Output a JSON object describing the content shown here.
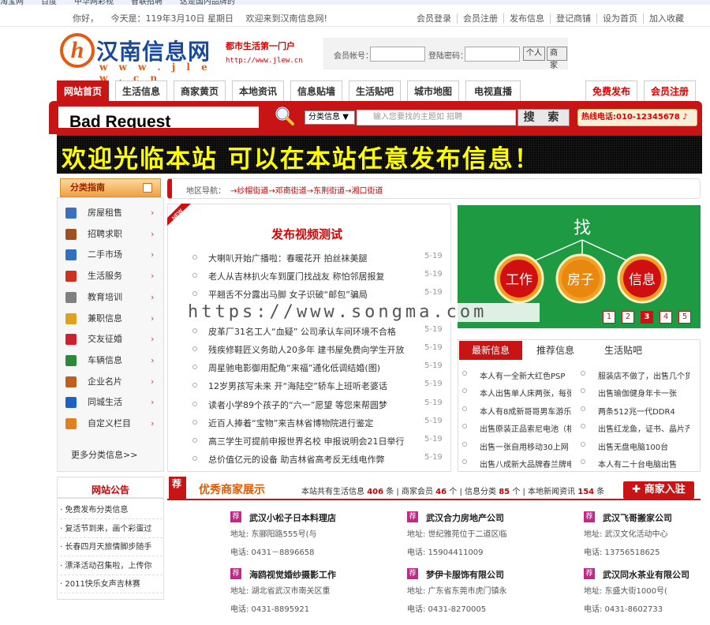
{
  "browser": {
    "bookmarks": [
      "淘宝网",
      "百度",
      "中华网彩视",
      "智联招聘",
      "这是国内品牌的"
    ]
  },
  "topbar": {
    "greeting": "你好，",
    "date": "今天是：119年3月10日 星期日",
    "welcome": "欢迎来到汉南信息网!",
    "links": [
      "会员登录",
      "会员注册",
      "发布信息",
      "登记商铺",
      "设为首页",
      "加入收藏"
    ]
  },
  "header": {
    "logo_letter": "h",
    "logo_text": "汉南信息网",
    "logo_url": "w w w . j l e w . c n",
    "slogan": "都市生活第一门户",
    "slogan_url": "http://www.jlew.cn",
    "login": {
      "account_label": "会员帐号：",
      "password_label": "登陆密码：",
      "btn_personal": "个人",
      "btn_merchant": "商家"
    }
  },
  "nav": {
    "tabs": [
      "网站首页",
      "生活信息",
      "商家黄页",
      "本地资讯",
      "信息贴墙",
      "生活贴吧",
      "城市地图",
      "电视直播"
    ],
    "right": [
      "免费发布",
      "会员注册"
    ]
  },
  "search": {
    "error_text": "Bad Request",
    "category": "分类信息",
    "placeholder": "输入您要找的主题如 招聘",
    "button": "搜 索",
    "hotline": "热线电话:010-12345678"
  },
  "banner": {
    "text": "欢迎光临本站 可以在本站任意发布信息！"
  },
  "categories": {
    "title": "分类指南",
    "items": [
      "房屋租售",
      "招聘求职",
      "二手市场",
      "生活服务",
      "教育培训",
      "兼职信息",
      "交友征婚",
      "车辆信息",
      "企业名片",
      "同城生活",
      "自定义栏目"
    ],
    "icon_colors": [
      "#3a70c0",
      "#a05020",
      "#3070c0",
      "#d03020",
      "#808080",
      "#e0a020",
      "#d02030",
      "#2a8a3a",
      "#c06020",
      "#2060c0",
      "#e08020"
    ],
    "icon_names": [
      "house-icon",
      "person-icon",
      "monitor-icon",
      "lifebuoy-icon",
      "board-icon",
      "folder-icon",
      "heart-icon",
      "car-icon",
      "card-icon",
      "chart-icon",
      "gear-icon"
    ],
    "more": "更多分类信息>>"
  },
  "area": {
    "label": "地区导航：",
    "value": "→纱帽街道→邓南街道→东荆街道→湘口街道"
  },
  "video": {
    "badge": "NEW",
    "title": "发布视频测试",
    "items": [
      {
        "text": "大喇叭开始广播啦：春暖花开 拍丝袜美腿",
        "date": "5-19"
      },
      {
        "text": "老人从吉林扒火车到厦门找战友 称怕邻居报复",
        "date": "5-19"
      },
      {
        "text": "平翘舌不分露出马脚 女子识破“邮包”骗局",
        "date": "5-19"
      },
      {
        "text": "",
        "date": ""
      },
      {
        "text": "皮革厂31名工人“血疑” 公司承认车间环境不合格",
        "date": "5-19"
      },
      {
        "text": "残疾修鞋匠义务助人20多年 建书屋免费向学生开放",
        "date": "5-19"
      },
      {
        "text": "周星驰电影御用配角“来福”通化低调结婚(图)",
        "date": "5-19"
      },
      {
        "text": "12岁男孩写未来 开“海陆空”轿车上班听老婆话",
        "date": "5-19"
      },
      {
        "text": "读者小学89个孩子的“六一”愿望 等您来帮圆梦",
        "date": "5-19"
      },
      {
        "text": "近百人捧着“宝物”来吉林省博物院进行鉴定",
        "date": "5-19"
      },
      {
        "text": "高三学生可提前申报世界名校 申报说明会21日举行",
        "date": "5-19"
      },
      {
        "text": "总价值亿元的设备 助吉林省高考反无线电作弊",
        "date": "5-19"
      }
    ]
  },
  "watermark": "https://www.songma.com",
  "diagram": {
    "center": "找",
    "nodes": [
      "工作",
      "房子",
      "信息"
    ],
    "pages": [
      "1",
      "2",
      "3",
      "4",
      "5"
    ],
    "active_page": "3"
  },
  "news": {
    "tabs": [
      "最新信息",
      "推荐信息",
      "生活贴吧"
    ],
    "left": [
      "本人有一全新大红色PSP",
      "本人出售单人床两张，每张",
      "本人有8成新哥哥男车游乐",
      "出售原装正品索尼电池（相",
      "出售一张自用移动30上网",
      "出售八成新大品牌春兰牌电"
    ],
    "right": [
      "服装店不做了，出售几个货",
      "出售瑜伽健身年卡一张",
      "两条512兆一代DDR4",
      "出售红龙鱼，证书、晶片齐",
      "出售无盘电脑100台",
      "本人有二十台电脑出售"
    ]
  },
  "notice": {
    "title": "网站公告",
    "items": [
      "· 免费发布分类信息",
      "· 复活节到来，画个彩蛋过",
      "· 长春四月天旅情脚步随手",
      "· 漂泽活动召集啦，上传你",
      "· 2011快乐女声吉林赛"
    ]
  },
  "merchants": {
    "tag": "荐",
    "title": "优秀商家展示",
    "stats": {
      "p1": "本站共有生活信息",
      "n1": "406",
      "p2": "条 | 商家会员",
      "n2": "46",
      "p3": "个 | 信息分类",
      "n3": "85",
      "p4": "个 | 本地新闻资讯",
      "n4": "154",
      "p5": "条"
    },
    "join": "✚ 商家入驻",
    "items": [
      {
        "name": "武汉小松子日本料理店",
        "addr": "地址: 东郦阳路555号(与",
        "phone": "电话: 0431－8896658"
      },
      {
        "name": "武汉合力房地产公司",
        "addr": "地址: 世纪雅苑位于二道区临",
        "phone": "电话: 15904411009"
      },
      {
        "name": "武汉飞哥搬家公司",
        "addr": "地址: 武汉文化活动中心",
        "phone": "电话: 13756518625"
      },
      {
        "name": "海鸥视觉婚纱摄影工作",
        "addr": "地址: 湖北省武汉市南关区重",
        "phone": "电话: 0431-8895921"
      },
      {
        "name": "梦伊卡服饰有限公司",
        "addr": "地址: 广东省东莞市虎门镇永",
        "phone": "电话: 0431-8270005"
      },
      {
        "name": "武汉同水茶业有限公司",
        "addr": "地址: 东盛大街1000号(",
        "phone": "电话: 0431-8602733"
      }
    ]
  },
  "colors": {
    "brand_red": "#c81414",
    "logo_orange": "#e55a10",
    "logo_blue": "#1a4a9c",
    "banner_yellow": "#ffff00",
    "green": "#1d9a42"
  }
}
